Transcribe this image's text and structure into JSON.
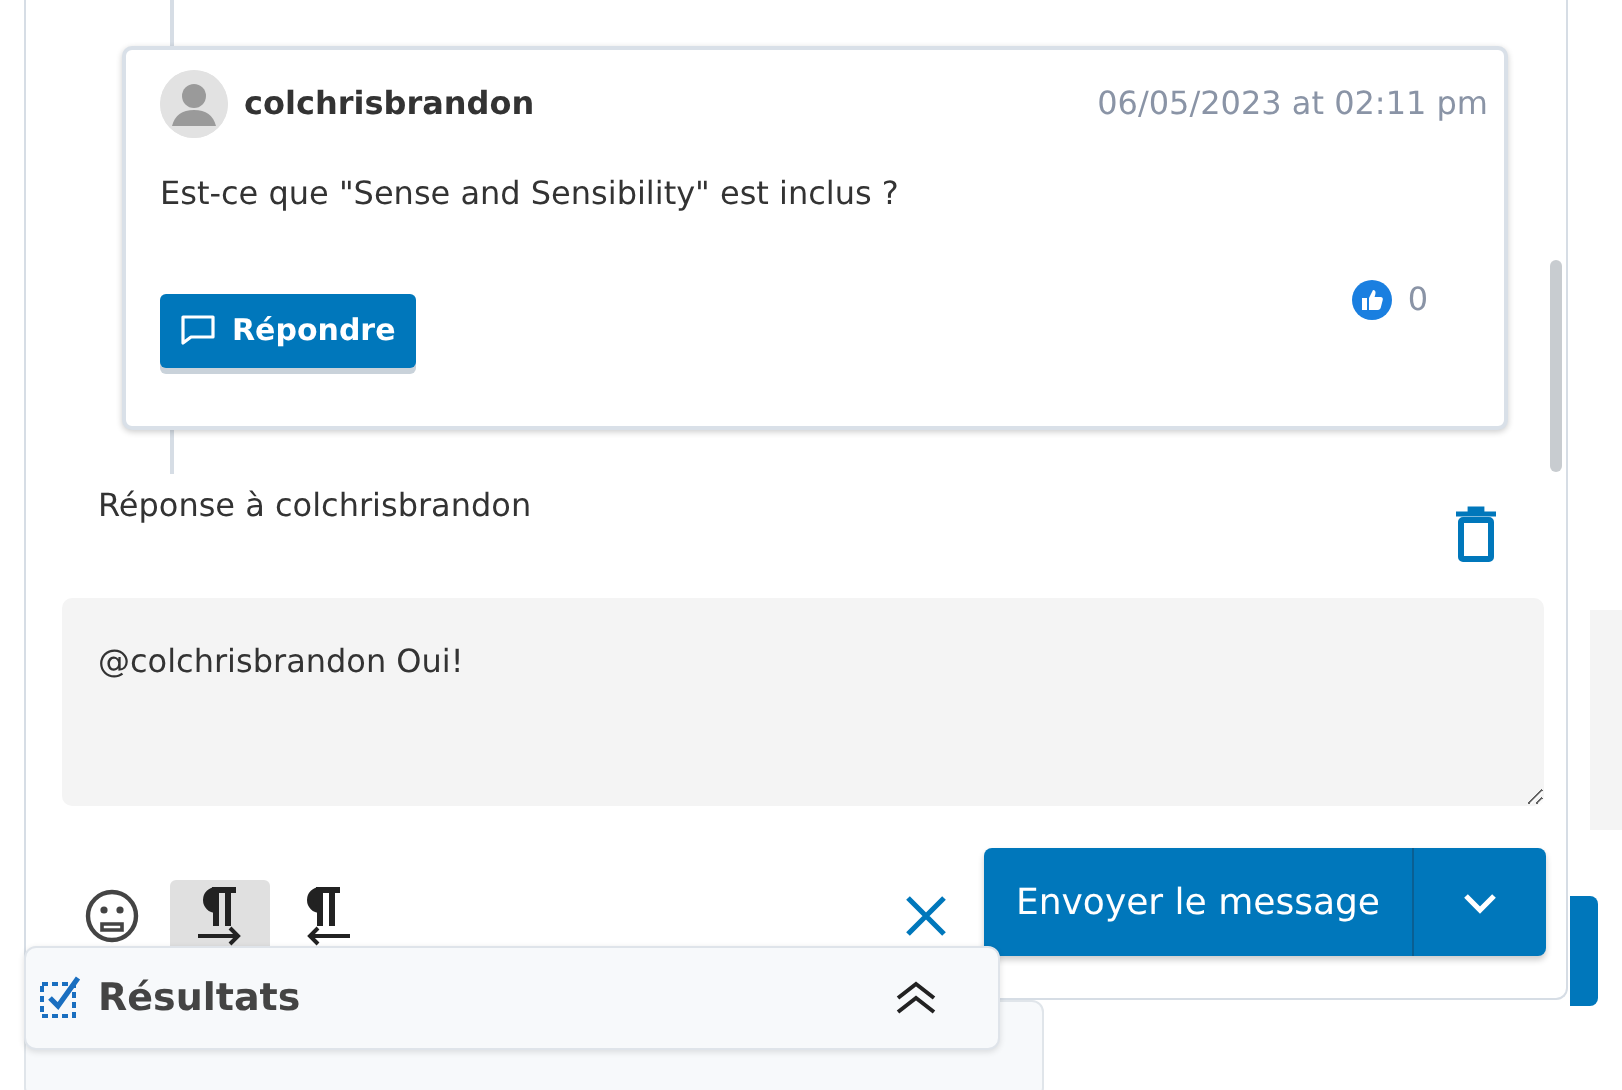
{
  "post": {
    "author": "colchrisbrandon",
    "timestamp": "06/05/2023 at 02:11 pm",
    "body": "Est-ce que \"Sense and Sensibility\" est inclus ?",
    "reply_button": "Répondre",
    "likes": "0"
  },
  "reply": {
    "label": "Réponse à colchrisbrandon",
    "text": "@colchrisbrandon Oui!"
  },
  "toolbar": [
    {
      "kind": "emoji",
      "selected": false
    },
    {
      "kind": "ltr",
      "selected": true
    },
    {
      "kind": "rtl",
      "selected": false
    }
  ],
  "send_button": "Envoyer le message",
  "results_panel": {
    "title": "Résultats"
  }
}
